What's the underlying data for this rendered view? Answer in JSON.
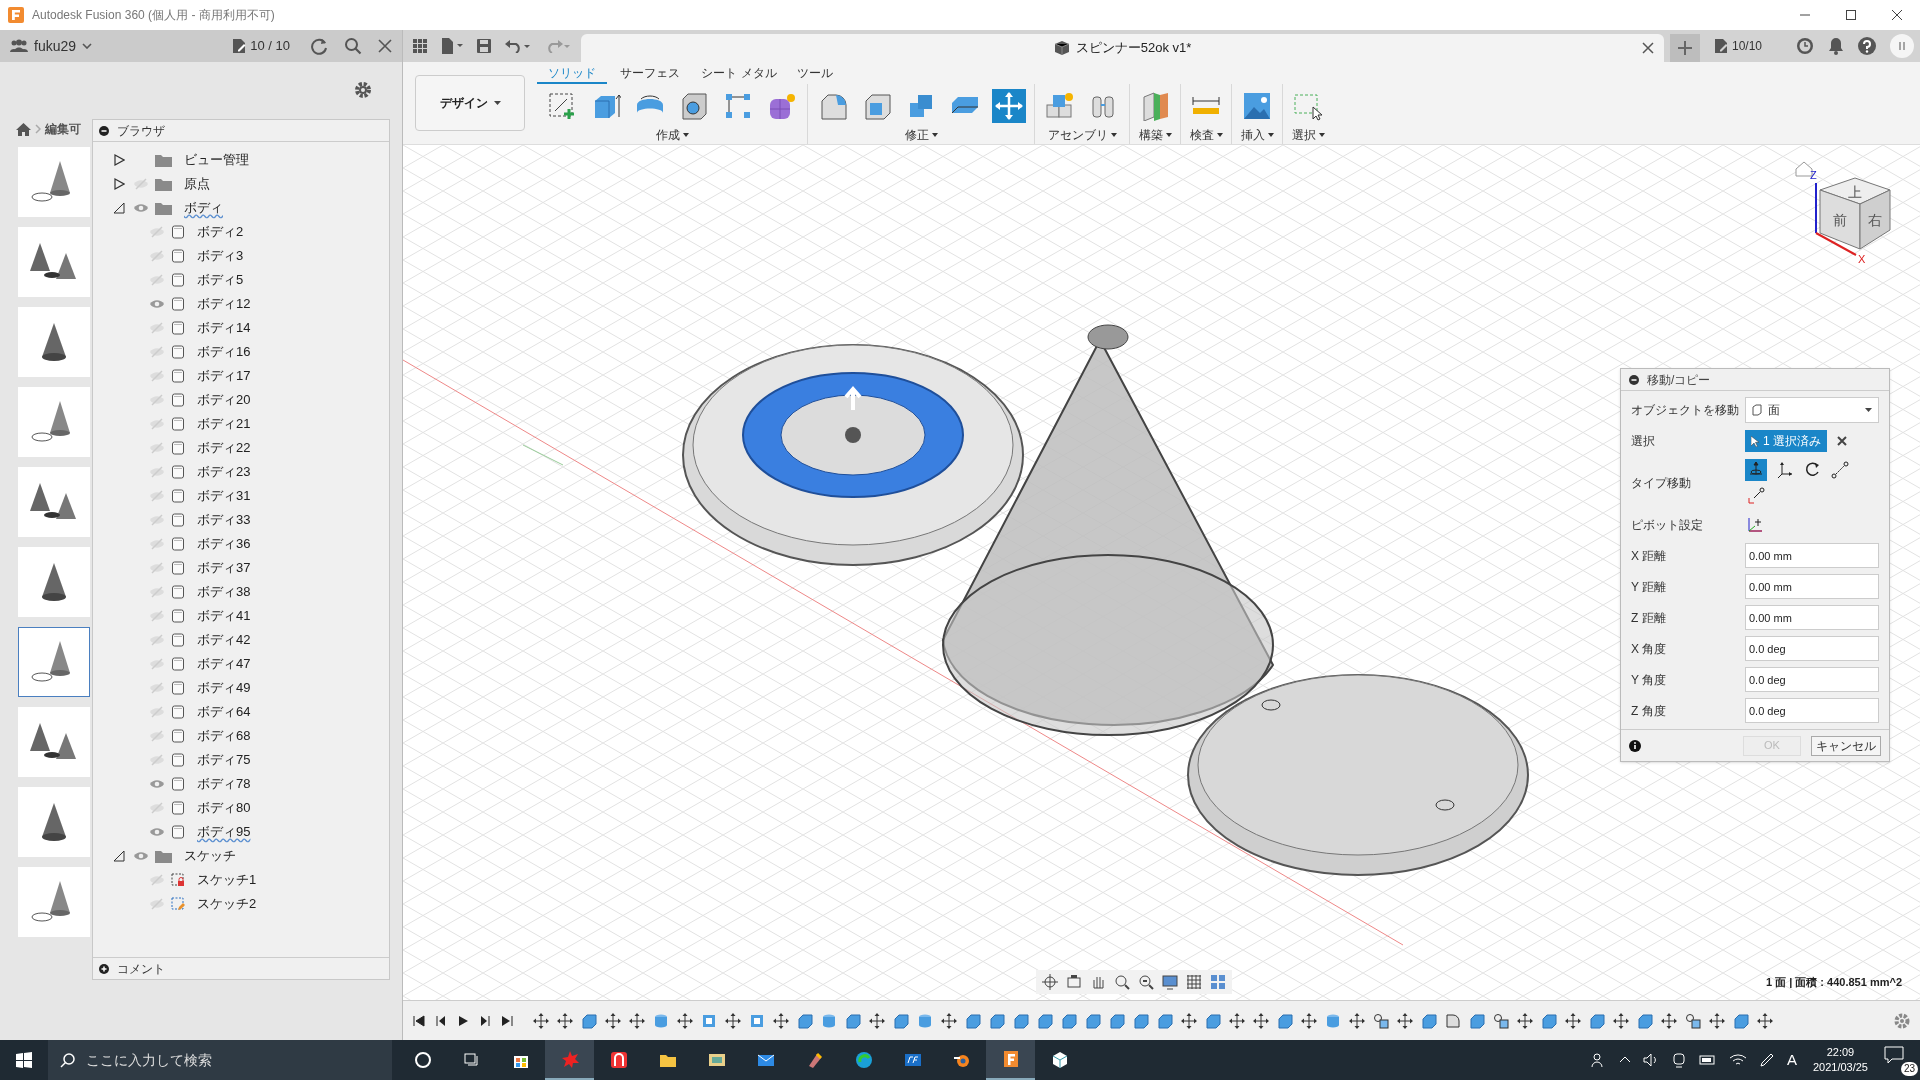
{
  "window": {
    "title": "Autodesk Fusion 360 (個人用 - 商用利用不可)"
  },
  "data_panel": {
    "team": "fuku29",
    "count": "10 / 10",
    "breadcrumb": "編集可",
    "thumbnails": [
      {
        "selected": false
      },
      {
        "selected": false
      },
      {
        "selected": false
      },
      {
        "selected": false
      },
      {
        "selected": false
      },
      {
        "selected": false
      },
      {
        "selected": true
      },
      {
        "selected": false
      },
      {
        "selected": false
      },
      {
        "selected": false
      }
    ]
  },
  "browser": {
    "title": "ブラウザ",
    "comments": "コメント",
    "tree": [
      {
        "label": "ビュー管理",
        "kind": "folder",
        "expanded": false
      },
      {
        "label": "原点",
        "kind": "folder",
        "expanded": false,
        "visible": false
      },
      {
        "label": "ボディ",
        "kind": "folder",
        "expanded": true,
        "visible": true,
        "flagged": true,
        "children": [
          {
            "label": "ボディ2",
            "kind": "body",
            "visible": false
          },
          {
            "label": "ボディ3",
            "kind": "body",
            "visible": false
          },
          {
            "label": "ボディ5",
            "kind": "body",
            "visible": false
          },
          {
            "label": "ボディ12",
            "kind": "body",
            "visible": true
          },
          {
            "label": "ボディ14",
            "kind": "body",
            "visible": false
          },
          {
            "label": "ボディ16",
            "kind": "body",
            "visible": false
          },
          {
            "label": "ボディ17",
            "kind": "body",
            "visible": false
          },
          {
            "label": "ボディ20",
            "kind": "body",
            "visible": false
          },
          {
            "label": "ボディ21",
            "kind": "body",
            "visible": false
          },
          {
            "label": "ボディ22",
            "kind": "body",
            "visible": false
          },
          {
            "label": "ボディ23",
            "kind": "body",
            "visible": false
          },
          {
            "label": "ボディ31",
            "kind": "body",
            "visible": false
          },
          {
            "label": "ボディ33",
            "kind": "body",
            "visible": false
          },
          {
            "label": "ボディ36",
            "kind": "body",
            "visible": false
          },
          {
            "label": "ボディ37",
            "kind": "body",
            "visible": false
          },
          {
            "label": "ボディ38",
            "kind": "body",
            "visible": false
          },
          {
            "label": "ボディ41",
            "kind": "body",
            "visible": false
          },
          {
            "label": "ボディ42",
            "kind": "body",
            "visible": false
          },
          {
            "label": "ボディ47",
            "kind": "body",
            "visible": false
          },
          {
            "label": "ボディ49",
            "kind": "body",
            "visible": false
          },
          {
            "label": "ボディ64",
            "kind": "body",
            "visible": false
          },
          {
            "label": "ボディ68",
            "kind": "body",
            "visible": false
          },
          {
            "label": "ボディ75",
            "kind": "body",
            "visible": false
          },
          {
            "label": "ボディ78",
            "kind": "body",
            "visible": true
          },
          {
            "label": "ボディ80",
            "kind": "body",
            "visible": false
          },
          {
            "label": "ボディ95",
            "kind": "body",
            "visible": true,
            "flagged": true
          }
        ]
      },
      {
        "label": "スケッチ",
        "kind": "folder",
        "expanded": true,
        "visible": true,
        "children": [
          {
            "label": "スケッチ1",
            "kind": "sketch-locked",
            "visible": false
          },
          {
            "label": "スケッチ2",
            "kind": "sketch-edit",
            "visible": false
          }
        ]
      }
    ]
  },
  "document_tab": {
    "title": "スピンナー52ok v1*",
    "jobs": "10/10"
  },
  "workspace": {
    "label": "デザイン"
  },
  "ribbon_tabs": [
    {
      "label": "ソリッド",
      "selected": true
    },
    {
      "label": "サーフェス",
      "selected": false
    },
    {
      "label": "シート メタル",
      "selected": false
    },
    {
      "label": "ツール",
      "selected": false
    }
  ],
  "ribbon_groups": [
    {
      "label": "作成",
      "tools": [
        {
          "kind": "sketch",
          "active": false
        },
        {
          "kind": "extrude",
          "active": false
        },
        {
          "kind": "revolve",
          "active": false
        },
        {
          "kind": "hole",
          "active": false
        },
        {
          "kind": "pattern",
          "active": false
        },
        {
          "kind": "form",
          "active": false
        }
      ]
    },
    {
      "label": "修正",
      "tools": [
        {
          "kind": "fillet",
          "active": false
        },
        {
          "kind": "shell",
          "active": false
        },
        {
          "kind": "combine",
          "active": false
        },
        {
          "kind": "offset",
          "active": false
        },
        {
          "kind": "move",
          "active": true
        }
      ]
    },
    {
      "label": "アセンブリ",
      "tools": [
        {
          "kind": "component",
          "active": false
        },
        {
          "kind": "joint",
          "active": false
        }
      ]
    },
    {
      "label": "構築",
      "tools": [
        {
          "kind": "plane",
          "active": false
        }
      ]
    },
    {
      "label": "検査",
      "tools": [
        {
          "kind": "measure",
          "active": false
        }
      ]
    },
    {
      "label": "挿入",
      "tools": [
        {
          "kind": "image",
          "active": false
        }
      ]
    },
    {
      "label": "選択",
      "tools": [
        {
          "kind": "select",
          "active": false
        }
      ]
    }
  ],
  "viewcube": {
    "faces": [
      "上",
      "前",
      "右"
    ],
    "axes": [
      "Z",
      "X"
    ]
  },
  "dialog": {
    "title": "移動/コピー",
    "object_label": "オブジェクトを移動",
    "object_value": "面",
    "selection_label": "選択",
    "selection_value": "1 選択済み",
    "type_label": "タイプ移動",
    "move_types": [
      {
        "kind": "free",
        "selected": true
      },
      {
        "kind": "translate",
        "selected": false
      },
      {
        "kind": "rotate",
        "selected": false
      },
      {
        "kind": "point",
        "selected": false
      },
      {
        "kind": "point-position",
        "selected": false
      }
    ],
    "pivot_label": "ピボット設定",
    "fields": [
      {
        "label": "X 距離",
        "value": "0.00 mm"
      },
      {
        "label": "Y 距離",
        "value": "0.00 mm"
      },
      {
        "label": "Z 距離",
        "value": "0.00 mm"
      },
      {
        "label": "X 角度",
        "value": "0.0 deg"
      },
      {
        "label": "Y 角度",
        "value": "0.0 deg"
      },
      {
        "label": "Z 角度",
        "value": "0.0 deg"
      }
    ],
    "ok": {
      "label": "OK",
      "disabled": true
    },
    "cancel": "キャンセル"
  },
  "status": "1 面 | 面積 : 440.851 mm^2",
  "timeline": [
    {
      "kind": "move"
    },
    {
      "kind": "move"
    },
    {
      "kind": "body"
    },
    {
      "kind": "move"
    },
    {
      "kind": "move"
    },
    {
      "kind": "cylinder"
    },
    {
      "kind": "move"
    },
    {
      "kind": "shell"
    },
    {
      "kind": "move"
    },
    {
      "kind": "shell"
    },
    {
      "kind": "move"
    },
    {
      "kind": "body"
    },
    {
      "kind": "cylinder"
    },
    {
      "kind": "body"
    },
    {
      "kind": "move"
    },
    {
      "kind": "body"
    },
    {
      "kind": "cylinder"
    },
    {
      "kind": "move"
    },
    {
      "kind": "body"
    },
    {
      "kind": "body"
    },
    {
      "kind": "body"
    },
    {
      "kind": "body"
    },
    {
      "kind": "body"
    },
    {
      "kind": "body"
    },
    {
      "kind": "body"
    },
    {
      "kind": "body"
    },
    {
      "kind": "body"
    },
    {
      "kind": "move"
    },
    {
      "kind": "body"
    },
    {
      "kind": "move"
    },
    {
      "kind": "move"
    },
    {
      "kind": "body"
    },
    {
      "kind": "move"
    },
    {
      "kind": "cylinder"
    },
    {
      "kind": "move"
    },
    {
      "kind": "split"
    },
    {
      "kind": "move"
    },
    {
      "kind": "body"
    },
    {
      "kind": "fillet"
    },
    {
      "kind": "body"
    },
    {
      "kind": "split"
    },
    {
      "kind": "move"
    },
    {
      "kind": "body"
    },
    {
      "kind": "move"
    },
    {
      "kind": "body"
    },
    {
      "kind": "move"
    },
    {
      "kind": "body"
    },
    {
      "kind": "move"
    },
    {
      "kind": "split"
    },
    {
      "kind": "move"
    },
    {
      "kind": "body"
    },
    {
      "kind": "move"
    }
  ],
  "taskbar": {
    "search_placeholder": "ここに入力して検索",
    "time": "22:09",
    "date": "2021/03/25",
    "ime": "A",
    "notifications": "23"
  }
}
